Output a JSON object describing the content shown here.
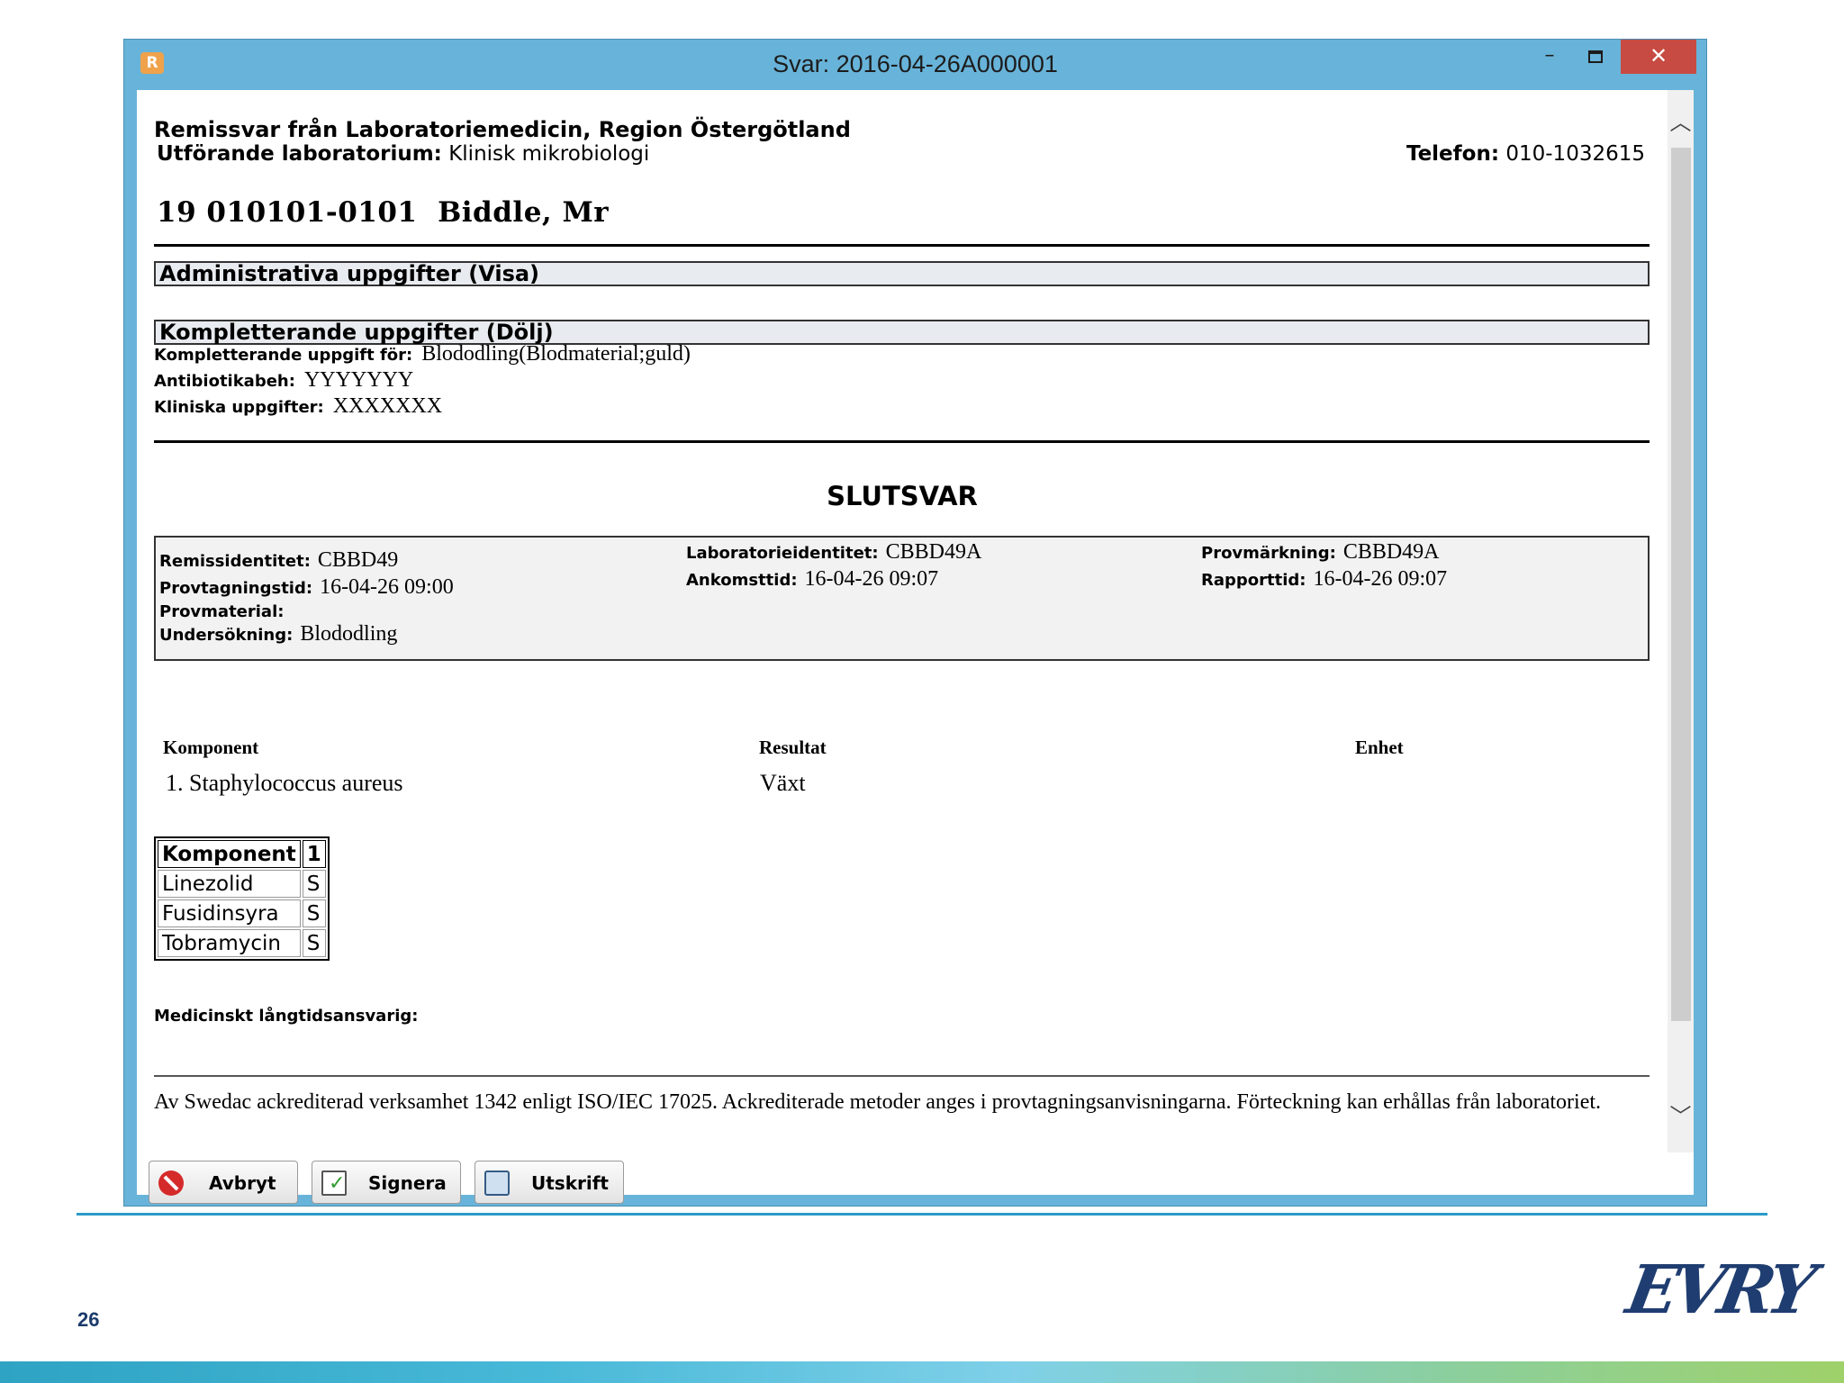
{
  "window": {
    "title": "Svar: 2016-04-26A000001",
    "app_icon": "R",
    "minimize": "–",
    "close": "✕"
  },
  "header": {
    "lab_title": "Remissvar från Laboratoriemedicin, Region Östergötland",
    "lab_label": "Utförande laboratorium:",
    "lab_value": "Klinisk mikrobiologi",
    "phone_label": "Telefon:",
    "phone_value": "010-1032615",
    "patient": "19 010101-0101  Biddle, Mr"
  },
  "sections": {
    "admin": "Administrativa uppgifter (Visa)",
    "complement": "Kompletterande uppgifter (Dölj)"
  },
  "complement": {
    "for_label": "Kompletterande uppgift för:",
    "for_value": "Blododling(Blodmaterial;guld)",
    "antibiotic_label": "Antibiotikabeh:",
    "antibiotic_value": "YYYYYYY",
    "clinical_label": "Kliniska uppgifter:",
    "clinical_value": "XXXXXXX"
  },
  "slutsvar": "SLUTSVAR",
  "info": {
    "remiss_label": "Remissidentitet:",
    "remiss_value": "CBBD49",
    "provtid_label": "Provtagningstid:",
    "provtid_value": "16-04-26 09:00",
    "provmaterial_label": "Provmaterial:",
    "undersokning_label": "Undersökning:",
    "undersokning_value": "Blododling",
    "labid_label": "Laboratorieidentitet:",
    "labid_value": "CBBD49A",
    "ankomst_label": "Ankomsttid:",
    "ankomst_value": "16-04-26 09:07",
    "provmark_label": "Provmärkning:",
    "provmark_value": "CBBD49A",
    "rapport_label": "Rapporttid:",
    "rapport_value": "16-04-26 09:07"
  },
  "results": {
    "col_komponent": "Komponent",
    "col_resultat": "Resultat",
    "col_enhet": "Enhet",
    "komponent": "1. Staphylococcus aureus",
    "resultat": "Växt"
  },
  "antibiogram": {
    "header": [
      "Komponent",
      "1"
    ],
    "rows": [
      [
        "Linezolid",
        "S"
      ],
      [
        "Fusidinsyra",
        "S"
      ],
      [
        "Tobramycin",
        "S"
      ]
    ]
  },
  "med_ansvarig": "Medicinskt långtidsansvarig:",
  "footer_note": "Av Swedac ackrediterad verksamhet 1342 enligt ISO/IEC 17025. Ackrediterade metoder anges i provtagningsanvisningarna. Förteckning kan erhållas från laboratoriet.",
  "buttons": {
    "cancel": "Avbryt",
    "sign": "Signera",
    "print": "Utskrift"
  },
  "slide": {
    "page_number": "26",
    "logo": "EVRY"
  }
}
